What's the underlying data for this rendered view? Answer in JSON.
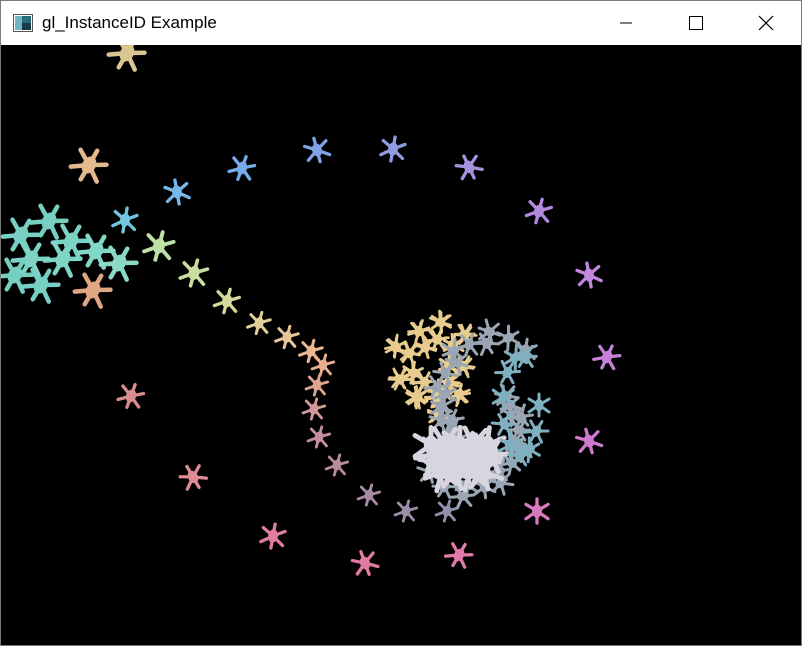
{
  "window": {
    "title": "gl_InstanceID Example",
    "app_icon": "opengl-window-icon",
    "controls": [
      {
        "name": "minimize",
        "icon": "minimize-icon"
      },
      {
        "name": "maximize",
        "icon": "maximize-icon"
      },
      {
        "name": "close",
        "icon": "close-icon"
      }
    ]
  },
  "viewport": {
    "background": "#000000",
    "content": "instanced-creatures-render"
  },
  "colors": {
    "titlebar": "#ffffff",
    "title_text": "#000000",
    "border": "#7a7a7a"
  }
}
